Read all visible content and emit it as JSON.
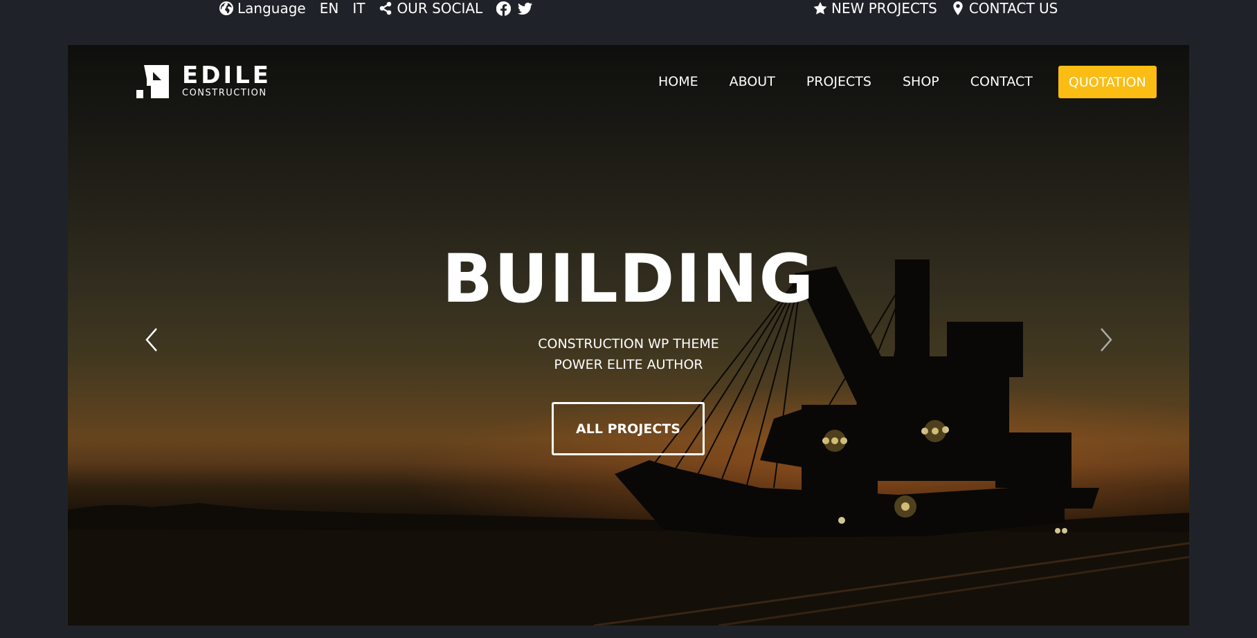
{
  "topbar": {
    "language_label": "Language",
    "languages": [
      "EN",
      "IT"
    ],
    "social_label": "OUR SOCIAL",
    "new_projects_label": "NEW PROJECTS",
    "contact_label": "CONTACT US"
  },
  "logo": {
    "name": "EDILE",
    "tagline": "CONSTRUCTION"
  },
  "nav": {
    "items": [
      "HOME",
      "ABOUT",
      "PROJECTS",
      "SHOP",
      "CONTACT"
    ],
    "quotation_label": "QUOTATION"
  },
  "slide": {
    "title": "BUILDING",
    "subtitle_line1": "CONSTRUCTION WP THEME",
    "subtitle_line2": "POWER ELITE AUTHOR",
    "cta_label": "ALL PROJECTS"
  },
  "colors": {
    "page_background": "#1f2329",
    "accent": "#fbbd14",
    "text": "#ffffff"
  },
  "icons": [
    "globe-icon",
    "share-icon",
    "facebook-icon",
    "twitter-icon",
    "star-icon",
    "map-marker-icon",
    "chevron-left-icon",
    "chevron-right-icon"
  ]
}
